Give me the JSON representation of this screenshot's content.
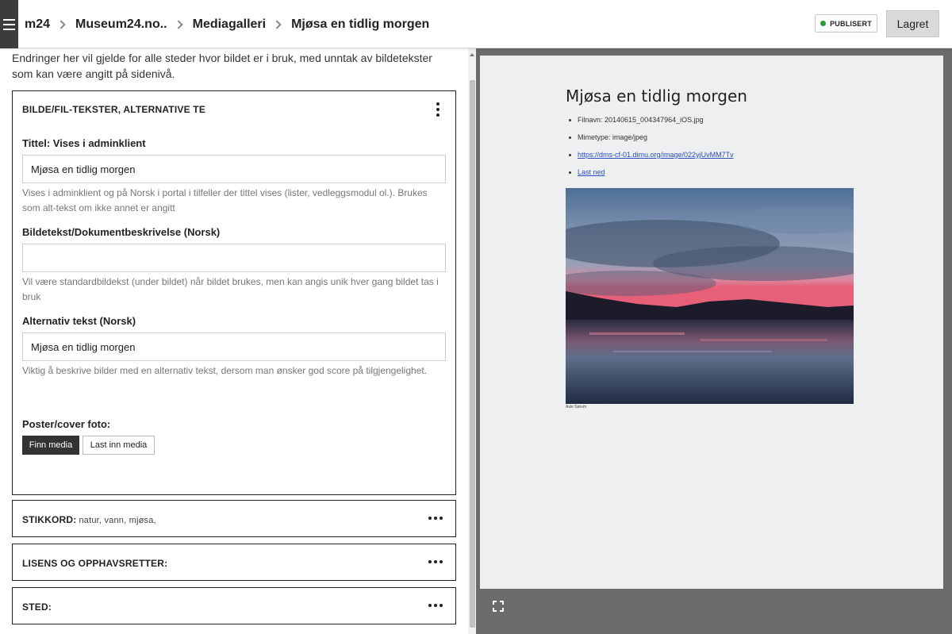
{
  "header": {
    "menu_icon": "hamburger-menu-icon",
    "breadcrumbs": [
      "m24",
      "Museum24.no..",
      "Mediagalleri",
      "Mjøsa en tidlig morgen"
    ],
    "status_label": "PUBLISERT",
    "status_color": "#2e9b33",
    "save_label": "Lagret"
  },
  "editor": {
    "intro": "Endringer her vil gjelde for alle steder hvor bildet er i bruk, med unntak av bildetekster som kan være angitt på sidenivå.",
    "section_texts": {
      "heading": "BILDE/FIL-TEKSTER, ALTERNATIVE TE",
      "title_label": "Tittel: Vises i adminklient",
      "title_value": "Mjøsa en tidlig morgen",
      "title_help": "Vises i adminklient og på Norsk i portal i tilfeller der tittel vises (lister, vedleggsmodul ol.). Brukes som alt-tekst om ikke annet er angitt",
      "caption_label": "Bildetekst/Dokumentbeskrivelse (Norsk)",
      "caption_value": "",
      "caption_help": "Vil være standardbildekst (under bildet) når bildet brukes, men kan angis unik hver gang bildet tas i bruk",
      "alt_label": "Alternativ tekst (Norsk)",
      "alt_value": "Mjøsa en tidlig morgen",
      "alt_help": "Viktig å beskrive bilder med en alternativ tekst, dersom man ønsker god score på tilgjengelighet.",
      "poster_label": "Poster/cover foto:",
      "find_media": "Finn media",
      "upload_media": "Last inn media"
    },
    "section_keywords": {
      "heading": "STIKKORD:",
      "values": "natur, vann, mjøsa,"
    },
    "section_license": {
      "heading": "LISENS OG OPPHAVSRETTER:"
    },
    "section_place": {
      "heading": "STED:"
    }
  },
  "preview": {
    "title": "Mjøsa en tidlig morgen",
    "filename": "Filnavn: 20140615_004347964_iOS.jpg",
    "mimetype": "Mimetype: image/jpeg",
    "url": "https://dms-cf-01.dimu.org/image/022yjUvMM7Tv",
    "download": "Last ned",
    "credit": "Asle Sørum",
    "expand_icon": "fullscreen-expand-icon"
  }
}
